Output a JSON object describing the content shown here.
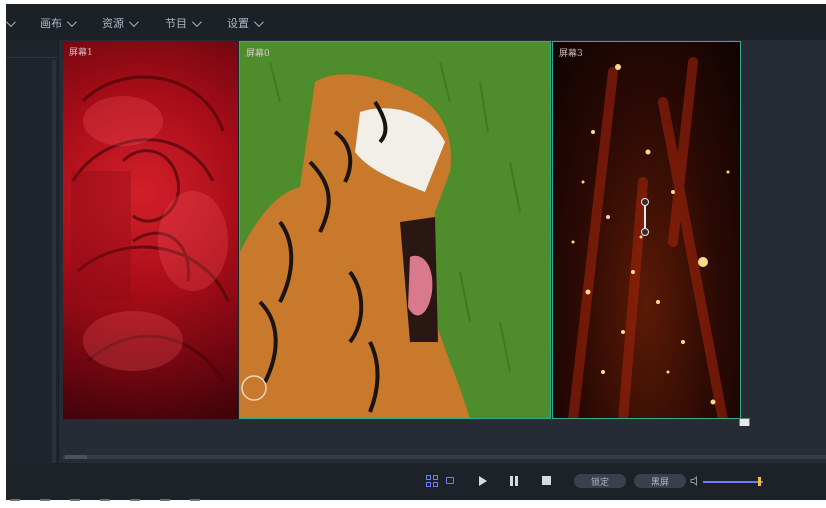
{
  "menu": {
    "items": [
      {
        "label": "画布"
      },
      {
        "label": "资源"
      },
      {
        "label": "节目"
      },
      {
        "label": "设置"
      }
    ]
  },
  "stage": {
    "screens": [
      {
        "label": "屏幕1",
        "content": "red-rose-image"
      },
      {
        "label": "屏幕0",
        "content": "tiger-yawning-image"
      },
      {
        "label": "屏幕3",
        "content": "golden-particles-image"
      }
    ]
  },
  "transport": {
    "lock_label": "锁定",
    "blackscreen_label": "黑屏",
    "volume": 0.95
  },
  "colors": {
    "accent": "#6c7cff",
    "selection_border": "#2fae8f",
    "volume_knob": "#f0c23c"
  }
}
